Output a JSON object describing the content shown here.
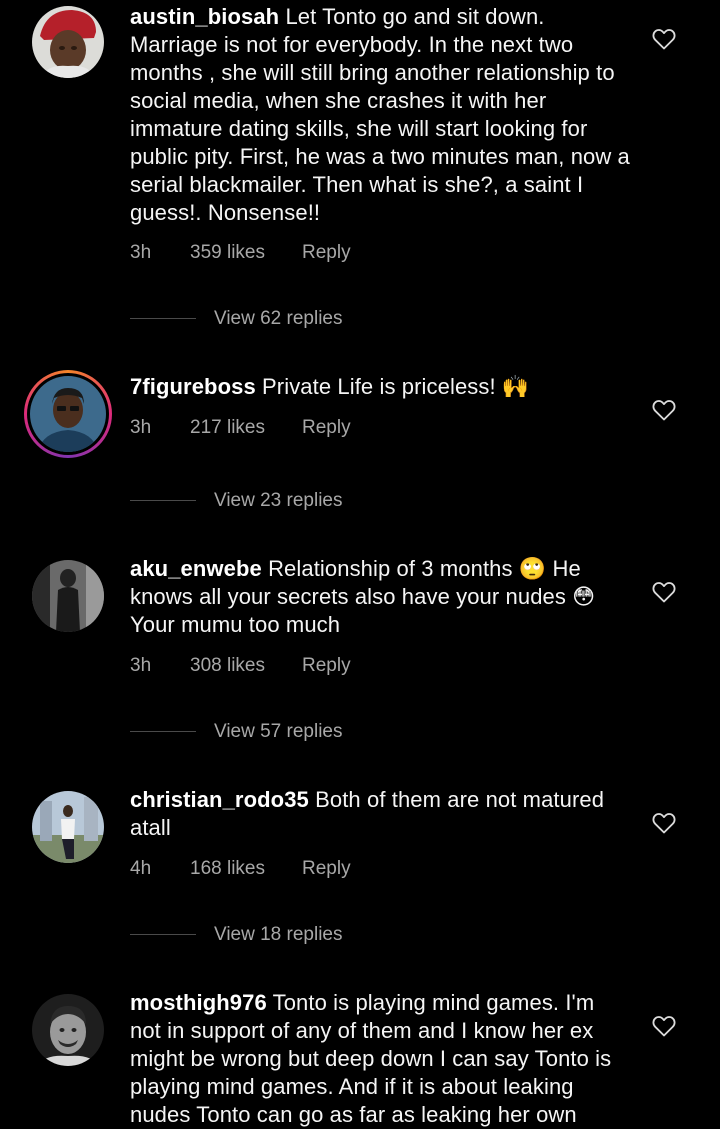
{
  "comments": [
    {
      "username": "austin_biosah",
      "text": "Let Tonto go and sit down. Marriage is not for everybody. In the next two months , she will still bring another relationship to social media, when she crashes it with her immature dating skills, she will start looking for public pity. First, he was a two minutes man, now a serial blackmailer. Then what is she?, a saint I guess!. Nonsense!!",
      "time": "3h",
      "likes": "359 likes",
      "reply": "Reply",
      "view_replies": "View 62 replies"
    },
    {
      "username": "7figureboss",
      "text": "Private Life is priceless! 🙌",
      "time": "3h",
      "likes": "217 likes",
      "reply": "Reply",
      "view_replies": "View 23 replies"
    },
    {
      "username": "aku_enwebe",
      "text": "Relationship of 3 months 🙄 He knows all your secrets also have your nudes 😳 Your mumu too much",
      "time": "3h",
      "likes": "308 likes",
      "reply": "Reply",
      "view_replies": "View 57 replies"
    },
    {
      "username": "christian_rodo35",
      "text": "Both of them are not matured atall",
      "time": "4h",
      "likes": "168 likes",
      "reply": "Reply",
      "view_replies": "View 18 replies"
    },
    {
      "username": "mosthigh976",
      "text": "Tonto is playing mind games. I'm not in support of any of them and I know her ex might be wrong but deep down I can say Tonto is playing mind games. And if it is about leaking nudes Tonto can go as far as leaking her own"
    }
  ],
  "icons": {
    "like": "heart-outline-icon"
  },
  "colors": {
    "background": "#000000",
    "text": "#f5f5f5",
    "secondary": "#a8a8a8"
  }
}
